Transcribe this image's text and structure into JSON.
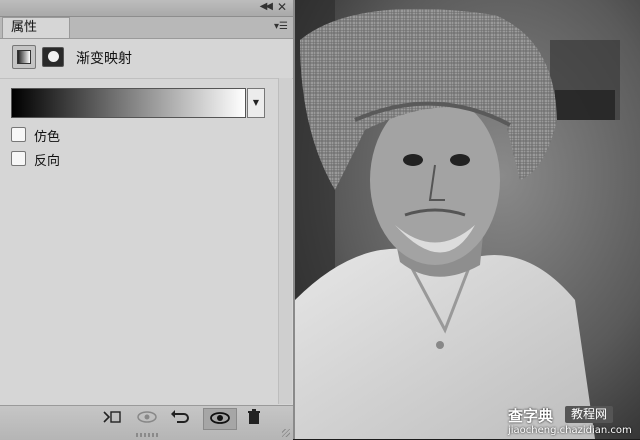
{
  "panel": {
    "tab_label": "属性",
    "title": "渐变映射",
    "dither_label": "仿色",
    "reverse_label": "反向",
    "dither_checked": false,
    "reverse_checked": false,
    "gradient": {
      "from": "#000000",
      "to": "#ffffff"
    }
  },
  "icons": {
    "collapse": "double-left-chevron",
    "close": "close",
    "menu": "panel-menu",
    "clip": "clip-to-layer",
    "view_previous": "eye-with-arrow",
    "reset": "undo-arrow",
    "visibility": "eye",
    "delete": "trash"
  },
  "watermark": {
    "main": "查字典",
    "tag": "教程网",
    "url": "jiaocheng.chazidian.com"
  }
}
